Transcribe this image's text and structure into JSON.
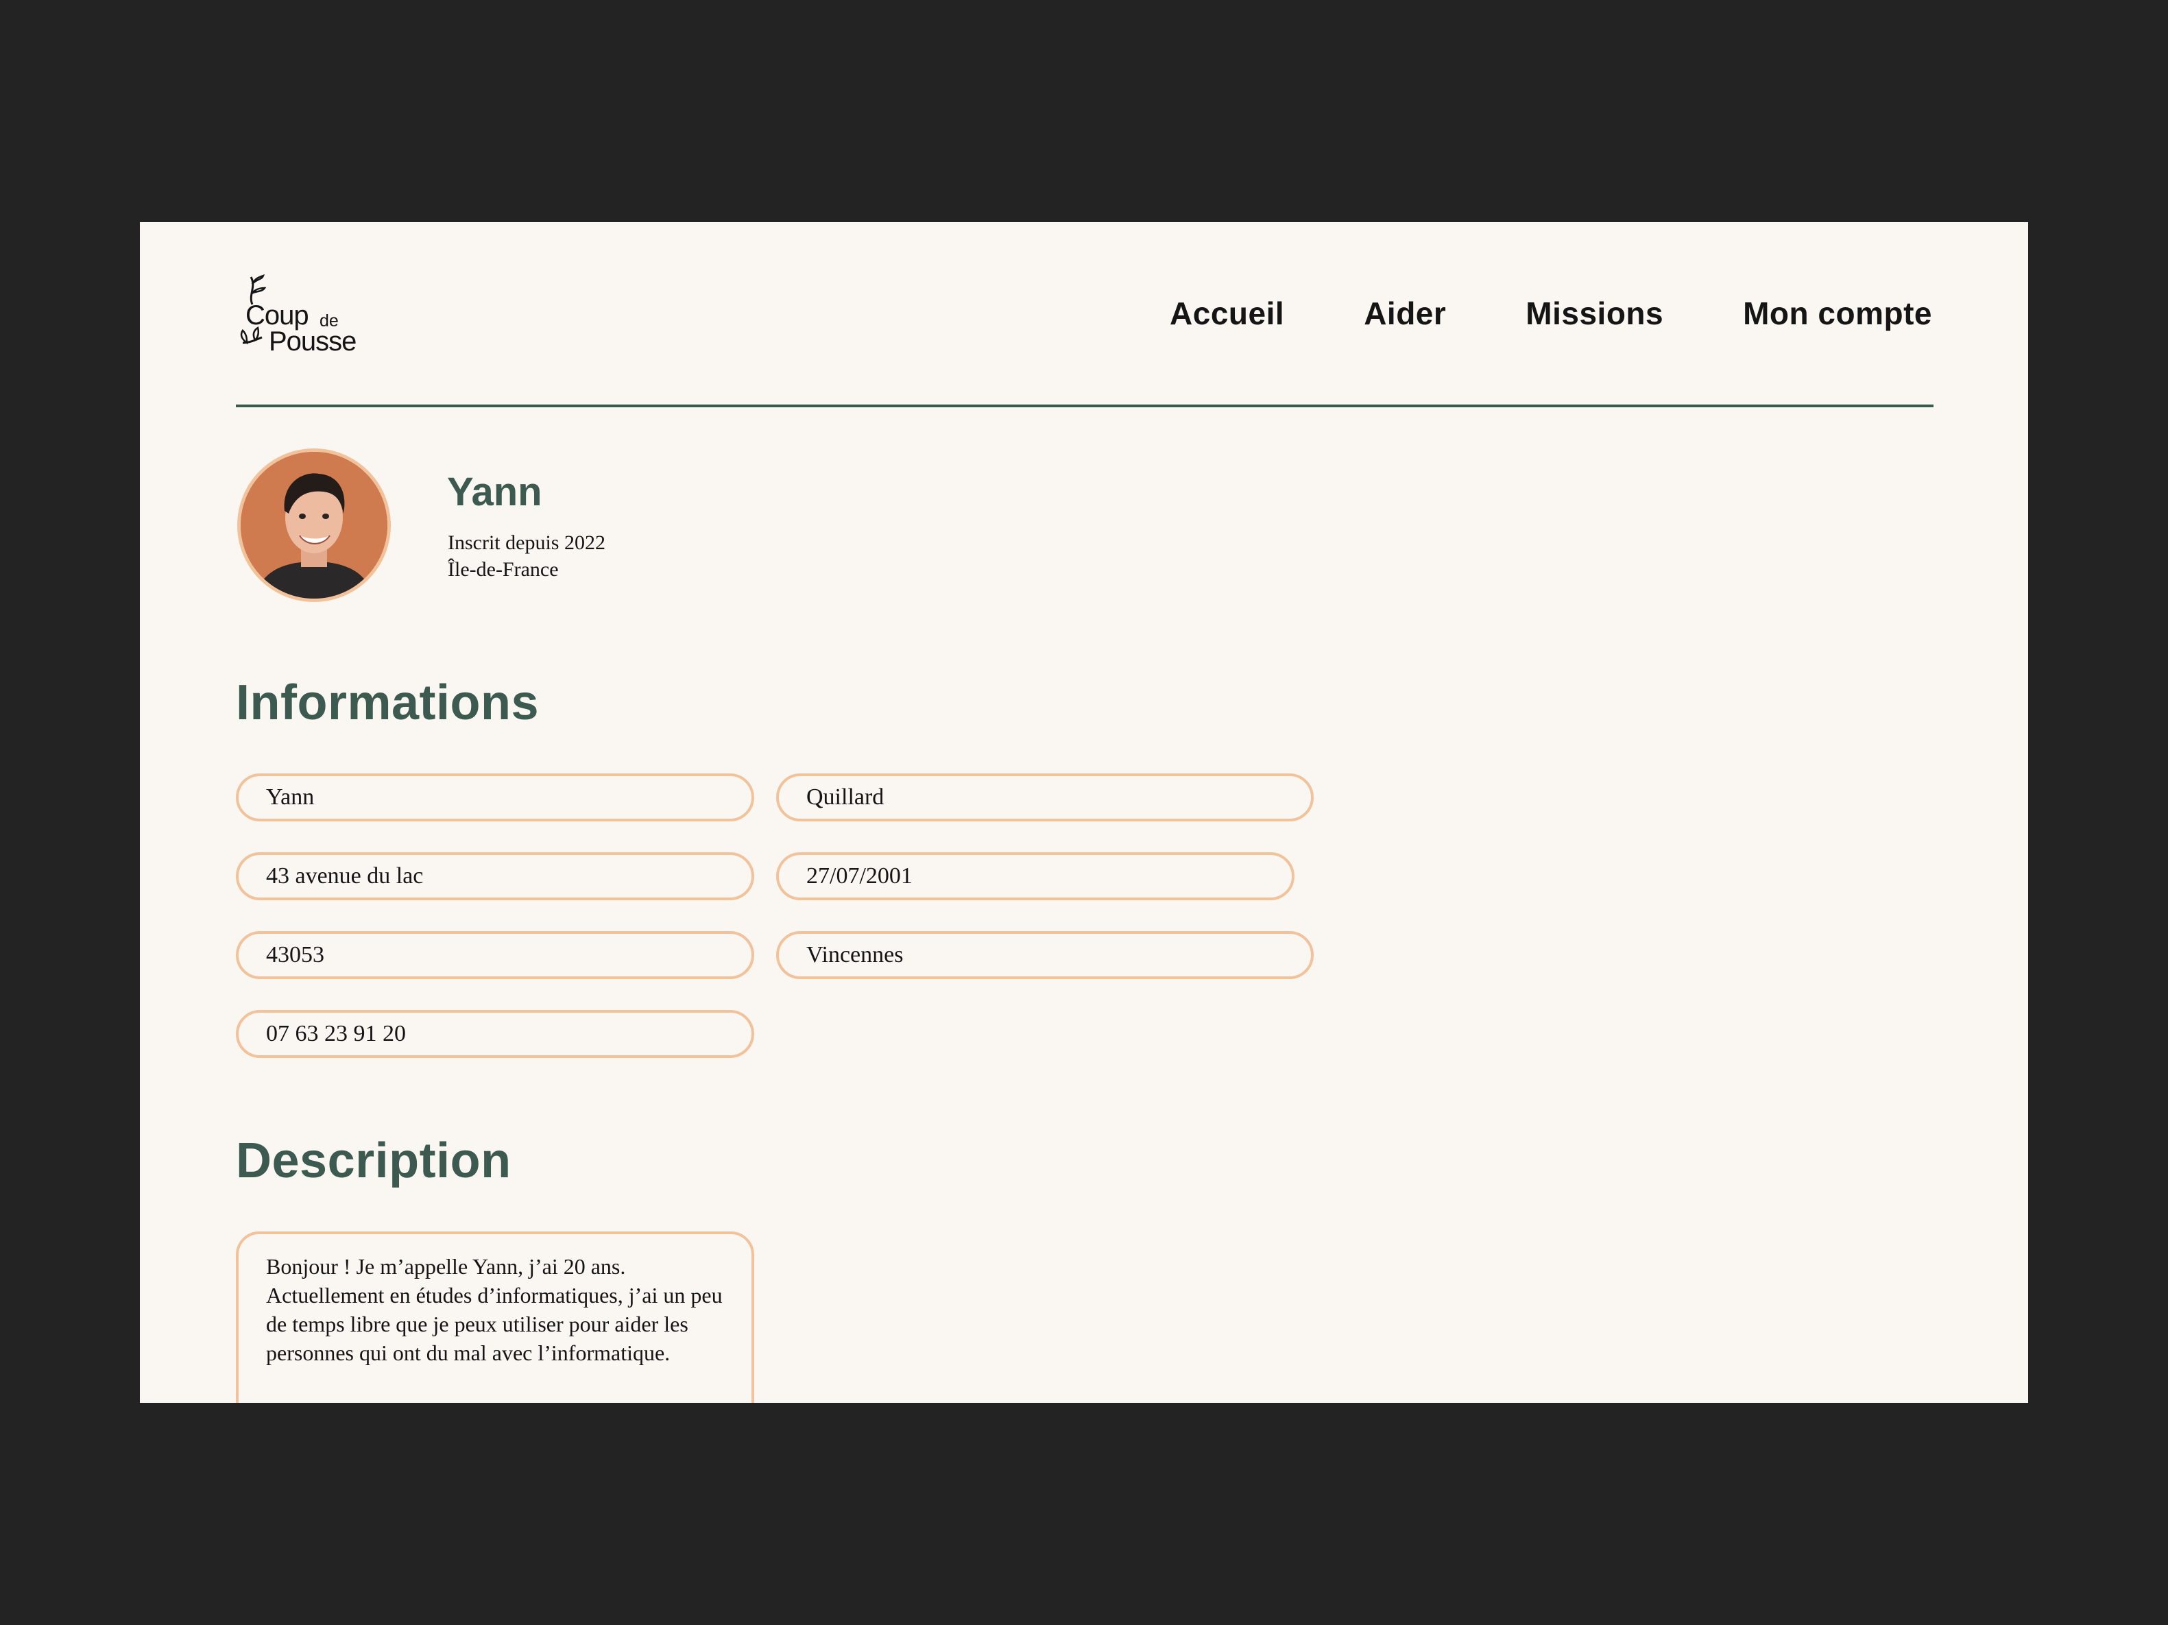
{
  "brand": {
    "logo_coup": "Coup",
    "logo_de": "de",
    "logo_pousse": "Pousse"
  },
  "nav": {
    "items": [
      {
        "label": "Accueil"
      },
      {
        "label": "Aider"
      },
      {
        "label": "Missions"
      },
      {
        "label": "Mon compte"
      }
    ]
  },
  "profile": {
    "name": "Yann",
    "member_since": "Inscrit depuis 2022",
    "region": "Île-de-France"
  },
  "informations": {
    "title": "Informations",
    "first_name": "Yann",
    "last_name": "Quillard",
    "address": "43 avenue du lac",
    "birth_date": "27/07/2001",
    "postal_code": "43053",
    "city": "Vincennes",
    "phone": "07 63 23 91 20"
  },
  "description": {
    "title": "Description",
    "text": "Bonjour ! Je m’appelle Yann, j’ai 20 ans. Actuellement en études d’informatiques, j’ai un peu de temps libre que je peux utiliser pour aider les personnes qui ont du mal avec l’informatique."
  },
  "colors": {
    "background": "#232323",
    "page": "#faf6f1",
    "accent_green": "#3c5a50",
    "field_border": "#f2c39a",
    "avatar_bg": "#cf7a4f"
  }
}
